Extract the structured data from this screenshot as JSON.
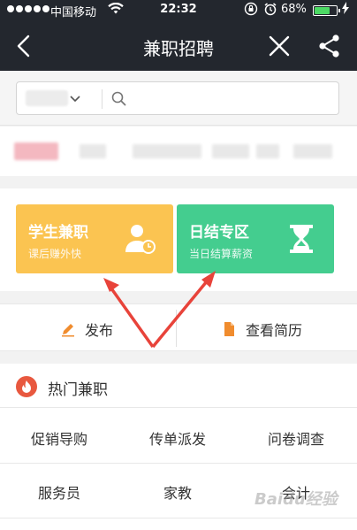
{
  "status_bar": {
    "carrier": "中国移动",
    "time": "22:32",
    "battery_pct": "68%",
    "battery_level": 0.68
  },
  "nav": {
    "title": "兼职招聘",
    "icons": [
      "back-icon",
      "close-icon",
      "share-icon"
    ]
  },
  "search": {
    "placeholder": "",
    "icon": "search-icon"
  },
  "cards": [
    {
      "title": "学生兼职",
      "subtitle": "课后赚外快",
      "color": "#fbc451",
      "icon": "person-clock-icon"
    },
    {
      "title": "日结专区",
      "subtitle": "当日结算薪资",
      "color": "#44cd8f",
      "icon": "hourglass-icon"
    }
  ],
  "actions": {
    "publish": "发布",
    "resume": "查看简历"
  },
  "hot": {
    "title": "热门兼职",
    "items": [
      "促销导购",
      "传单派发",
      "问卷调查",
      "服务员",
      "家教",
      "会计"
    ]
  },
  "colors": {
    "header_bg": "#23272e",
    "accent_orange": "#f08c2e",
    "fire_red": "#e8583f",
    "arrow_red": "#e8433a"
  },
  "watermark": "Baidu经验"
}
